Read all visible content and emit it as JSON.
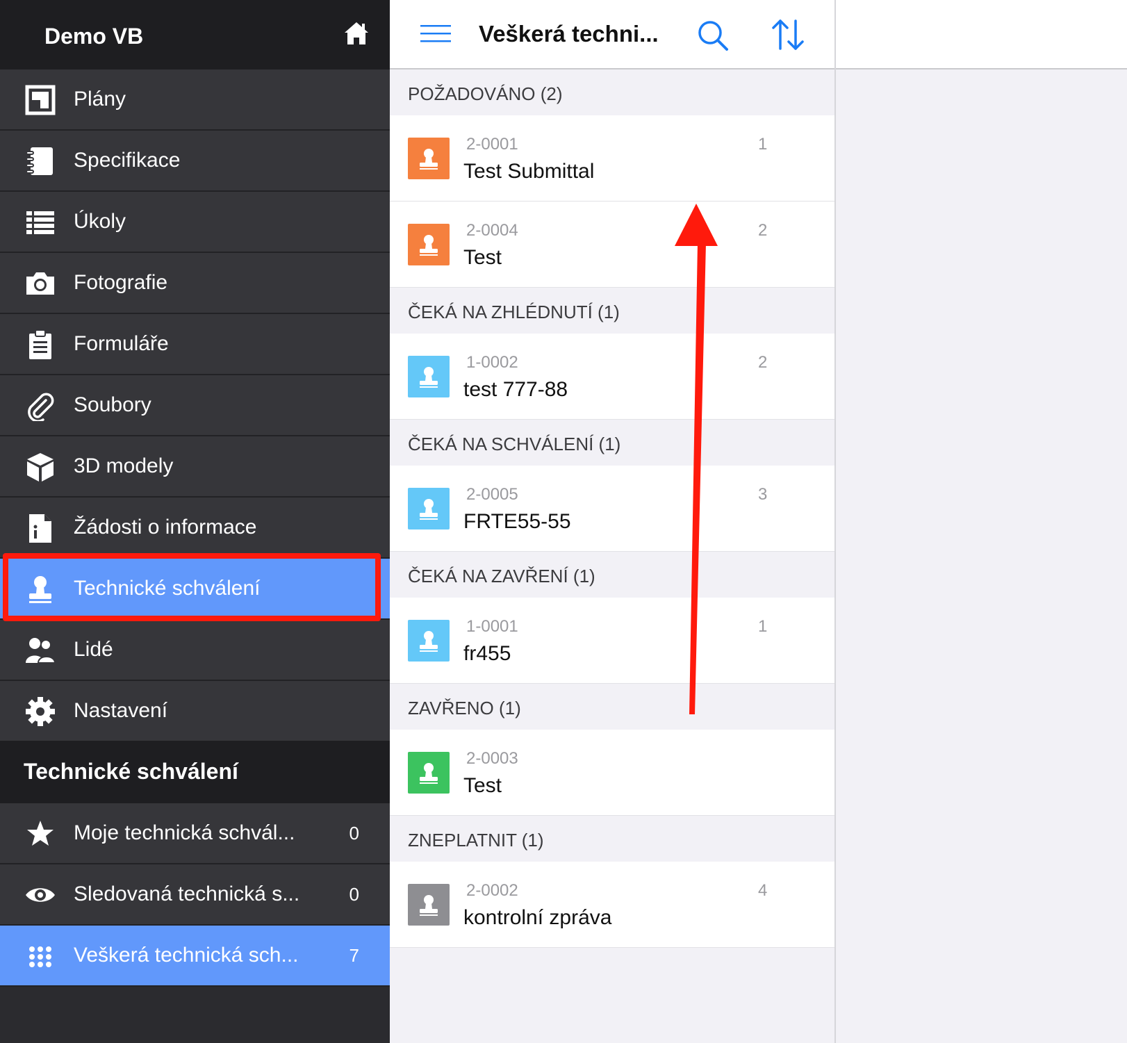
{
  "sidebar": {
    "project_title": "Demo VB",
    "items": [
      {
        "label": "Plány"
      },
      {
        "label": "Specifikace"
      },
      {
        "label": "Úkoly"
      },
      {
        "label": "Fotografie"
      },
      {
        "label": "Formuláře"
      },
      {
        "label": "Soubory"
      },
      {
        "label": "3D modely"
      },
      {
        "label": "Žádosti o informace"
      },
      {
        "label": "Technické schválení"
      },
      {
        "label": "Lidé"
      },
      {
        "label": "Nastavení"
      }
    ],
    "section_title": "Technické schválení",
    "filters": [
      {
        "label": "Moje technická schvál...",
        "count": "0"
      },
      {
        "label": "Sledovaná technická s...",
        "count": "0"
      },
      {
        "label": "Veškerá technická sch...",
        "count": "7"
      }
    ]
  },
  "list": {
    "title": "Veškerá techni...",
    "groups": [
      {
        "header": "POŽADOVÁNO (2)",
        "rows": [
          {
            "number": "2-0001",
            "name": "Test Submittal",
            "rev": "1",
            "color": "#f5803e"
          },
          {
            "number": "2-0004",
            "name": "Test",
            "rev": "2",
            "color": "#f5803e"
          }
        ]
      },
      {
        "header": "ČEKÁ NA ZHLÉDNUTÍ (1)",
        "rows": [
          {
            "number": "1-0002",
            "name": "test 777-88",
            "rev": "2",
            "color": "#64c8f8"
          }
        ]
      },
      {
        "header": "ČEKÁ NA SCHVÁLENÍ (1)",
        "rows": [
          {
            "number": "2-0005",
            "name": "FRTE55-55",
            "rev": "3",
            "color": "#64c8f8"
          }
        ]
      },
      {
        "header": "ČEKÁ NA ZAVŘENÍ (1)",
        "rows": [
          {
            "number": "1-0001",
            "name": "fr455",
            "rev": "1",
            "color": "#64c8f8"
          }
        ]
      },
      {
        "header": "ZAVŘENO (1)",
        "rows": [
          {
            "number": "2-0003",
            "name": "Test",
            "rev": "",
            "color": "#3cc35f"
          }
        ]
      },
      {
        "header": "ZNEPLATNIT (1)",
        "rows": [
          {
            "number": "2-0002",
            "name": "kontrolní zpráva",
            "rev": "4",
            "color": "#8e8e92"
          }
        ]
      }
    ]
  },
  "colors": {
    "accent": "#6198fb",
    "icon_blue": "#1a7cf5",
    "annotation_red": "#ff1a0c"
  }
}
